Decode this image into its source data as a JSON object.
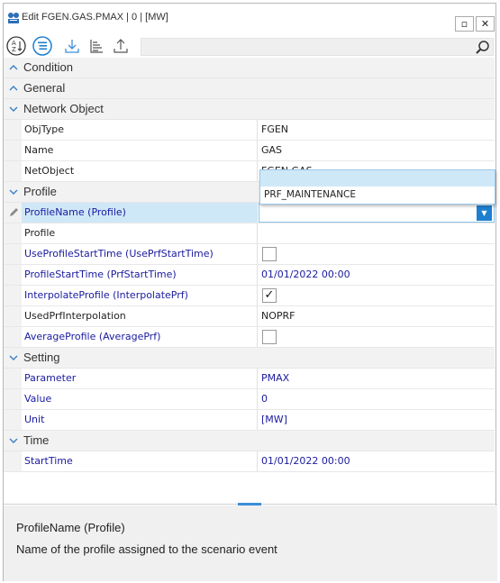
{
  "window": {
    "title": "Edit FGEN.GAS.PMAX | 0 | [MW]",
    "restore_glyph": "▫",
    "close_glyph": "✕"
  },
  "toolbar": {
    "icons": [
      "sort-az-icon",
      "categorized-icon",
      "download-icon",
      "hierarchy-icon",
      "upload-icon"
    ],
    "search_placeholder": ""
  },
  "categories": {
    "condition": "Condition",
    "general": "General",
    "network_object": "Network Object",
    "profile": "Profile",
    "setting": "Setting",
    "time": "Time"
  },
  "rows": {
    "objtype": {
      "name": "ObjType",
      "value": "FGEN"
    },
    "name": {
      "name": "Name",
      "value": "GAS"
    },
    "netobject": {
      "name": "NetObject",
      "value": "FGEN.GAS"
    },
    "profilename": {
      "name": "ProfileName (Profile)",
      "value": ""
    },
    "profile": {
      "name": "Profile",
      "value": ""
    },
    "useprofilestart": {
      "name": "UseProfileStartTime (UsePrfStartTime)",
      "value": ""
    },
    "profilestarttime": {
      "name": "ProfileStartTime (PrfStartTime)",
      "value": "01/01/2022 00:00"
    },
    "interpolateprofile": {
      "name": "InterpolateProfile (InterpolatePrf)",
      "value": "✓"
    },
    "usedprfinterp": {
      "name": "UsedPrfInterpolation",
      "value": "NOPRF"
    },
    "averageprofile": {
      "name": "AverageProfile (AveragePrf)",
      "value": ""
    },
    "parameter": {
      "name": "Parameter",
      "value": "PMAX"
    },
    "value": {
      "name": "Value",
      "value": "0"
    },
    "unit": {
      "name": "Unit",
      "value": "[MW]"
    },
    "starttime": {
      "name": "StartTime",
      "value": "01/01/2022 00:00"
    }
  },
  "dropdown": {
    "options": [
      "",
      "PRF_MAINTENANCE"
    ],
    "arrow": "▼"
  },
  "description": {
    "title": "ProfileName (Profile)",
    "text": "Name of the profile assigned to the scenario event"
  },
  "colors": {
    "accent": "#1e7fd0",
    "selection": "#cfe8f7",
    "editable_text": "#1a1aa0"
  }
}
